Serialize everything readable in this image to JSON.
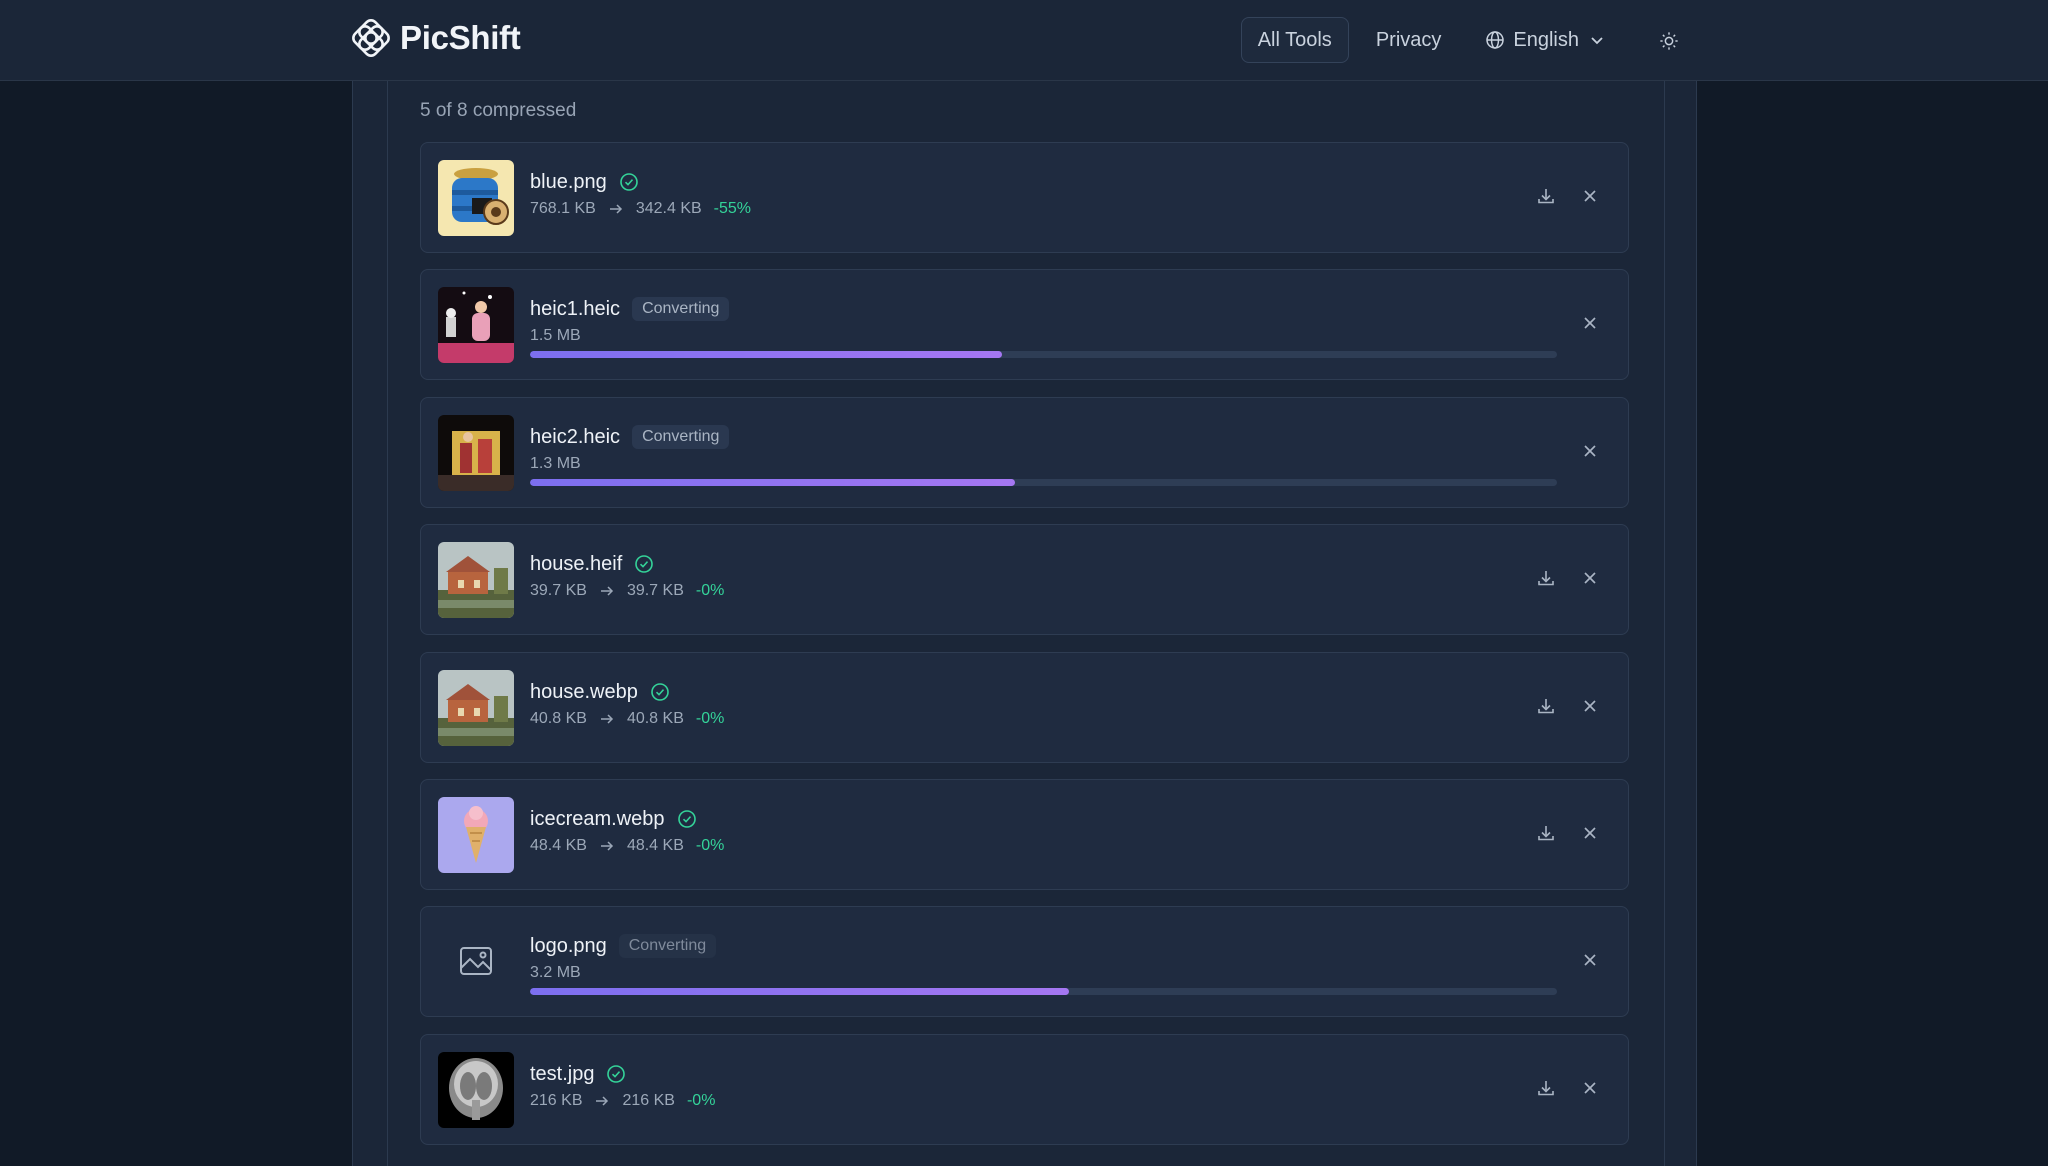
{
  "app": {
    "name": "PicShift"
  },
  "nav": {
    "all_tools": "All Tools",
    "privacy": "Privacy",
    "language": "English"
  },
  "summary": "5 of 8 compressed",
  "files": [
    {
      "name": "blue.png",
      "status": "done",
      "from": "768.1 KB",
      "to": "342.4 KB",
      "change": "-55%",
      "thumb": "blue-barrel-icon"
    },
    {
      "name": "heic1.heic",
      "status": "Converting",
      "size": "1.5 MB",
      "progress": 0.46,
      "thumb": "stage-performer-icon"
    },
    {
      "name": "heic2.heic",
      "status": "Converting",
      "size": "1.3 MB",
      "progress": 0.472,
      "thumb": "dancer-icon"
    },
    {
      "name": "house.heif",
      "status": "done",
      "from": "39.7 KB",
      "to": "39.7 KB",
      "change": "-0%",
      "thumb": "house-icon"
    },
    {
      "name": "house.webp",
      "status": "done",
      "from": "40.8 KB",
      "to": "40.8 KB",
      "change": "-0%",
      "thumb": "house-icon"
    },
    {
      "name": "icecream.webp",
      "status": "done",
      "from": "48.4 KB",
      "to": "48.4 KB",
      "change": "-0%",
      "thumb": "icecream-icon"
    },
    {
      "name": "logo.png",
      "status": "Converting",
      "size": "3.2 MB",
      "progress": 0.525,
      "thumb": "image-placeholder-icon"
    },
    {
      "name": "test.jpg",
      "status": "done",
      "from": "216 KB",
      "to": "216 KB",
      "change": "-0%",
      "thumb": "brain-scan-icon"
    }
  ],
  "colors": {
    "accent": "#8b74f2",
    "success": "#34d399",
    "card": "#1f2b40"
  }
}
